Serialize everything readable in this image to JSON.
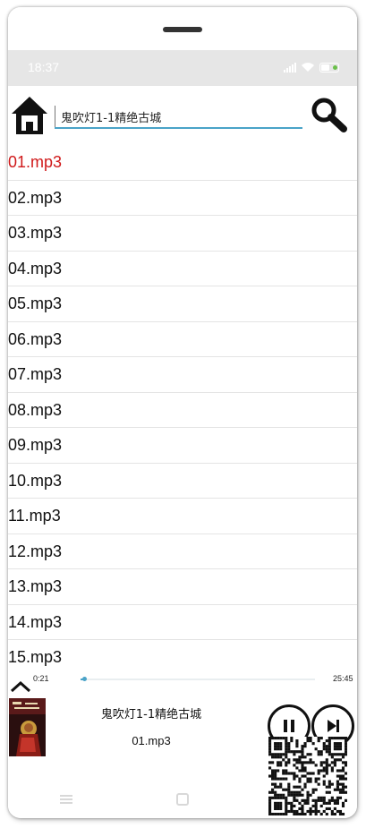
{
  "status_bar": {
    "time": "18:37",
    "icons": [
      "signal-icon",
      "wifi-icon",
      "battery-icon"
    ]
  },
  "toolbar": {
    "home_icon": "home-icon",
    "search_value": "鬼吹灯1-1精绝古城",
    "search_icon": "search-icon",
    "accent": "#4aa3c8"
  },
  "playlist": {
    "items": [
      "01.mp3",
      "02.mp3",
      "03.mp3",
      "04.mp3",
      "05.mp3",
      "06.mp3",
      "07.mp3",
      "08.mp3",
      "09.mp3",
      "10.mp3",
      "11.mp3",
      "12.mp3",
      "13.mp3",
      "14.mp3",
      "15.mp3"
    ],
    "active_index": 0,
    "active_color": "#d0191a"
  },
  "player": {
    "current_time": "0:21",
    "total_time": "25:45",
    "progress": 0.014,
    "album_title": "鬼吹灯1-1精绝古城",
    "track_name": "01.mp3",
    "collapse_icon": "chevron-up-icon",
    "pause_icon": "pause-icon",
    "next_icon": "skip-next-icon"
  },
  "nav_bar": {
    "icons": [
      "menu-icon",
      "home-square-icon",
      "back-icon"
    ]
  }
}
